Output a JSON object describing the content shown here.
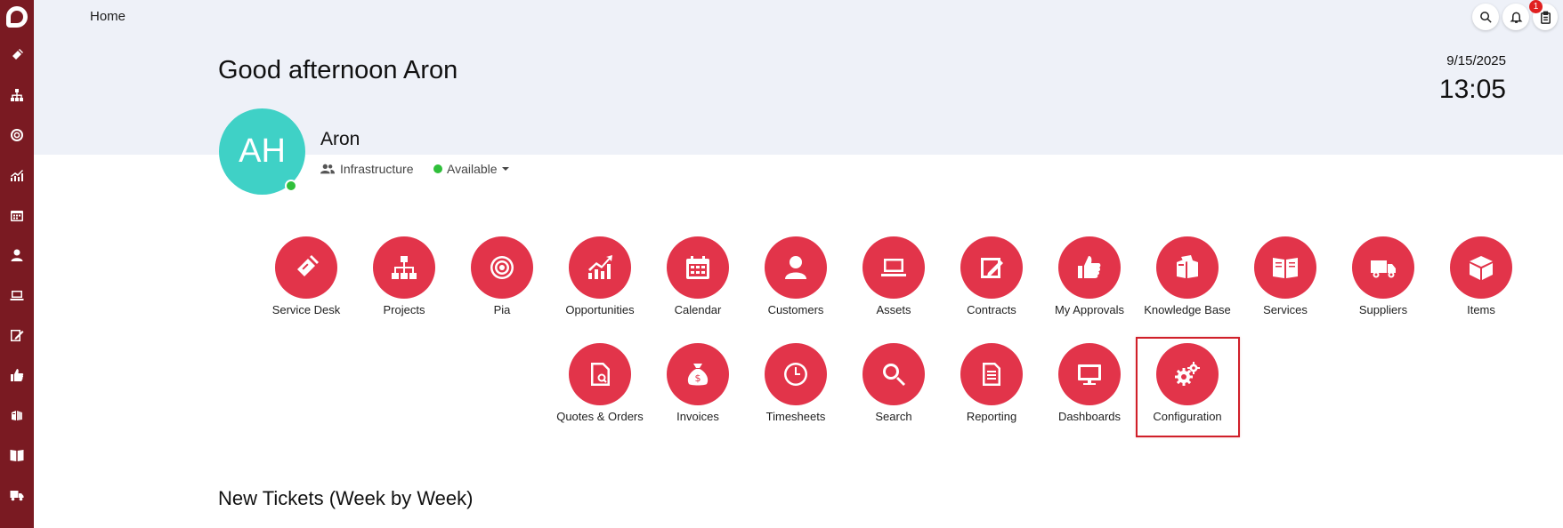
{
  "rail": {
    "icons": [
      "app-logo",
      "ticket-icon",
      "org-chart-icon",
      "target-icon",
      "chart-icon",
      "calendar-icon",
      "user-icon",
      "laptop-icon",
      "edit-icon",
      "thumbs-up-icon",
      "boxes-icon",
      "book-icon",
      "truck-icon"
    ]
  },
  "header": {
    "breadcrumb": "Home",
    "notification_count": "1"
  },
  "greeting": "Good afternoon Aron",
  "date": "9/15/2025",
  "time": "13:05",
  "profile": {
    "initials": "AH",
    "name": "Aron",
    "team": "Infrastructure",
    "status": "Available"
  },
  "tiles": {
    "row1": [
      {
        "label": "Service Desk",
        "icon": "ticket-icon"
      },
      {
        "label": "Projects",
        "icon": "org-chart-icon"
      },
      {
        "label": "Pia",
        "icon": "target-icon"
      },
      {
        "label": "Opportunities",
        "icon": "chart-icon"
      },
      {
        "label": "Calendar",
        "icon": "calendar-icon"
      },
      {
        "label": "Customers",
        "icon": "user-icon"
      },
      {
        "label": "Assets",
        "icon": "laptop-icon"
      },
      {
        "label": "Contracts",
        "icon": "edit-icon"
      },
      {
        "label": "My Approvals",
        "icon": "thumbs-up-icon"
      },
      {
        "label": "Knowledge Base",
        "icon": "boxes-icon"
      },
      {
        "label": "Services",
        "icon": "book-icon"
      },
      {
        "label": "Suppliers",
        "icon": "truck-icon"
      },
      {
        "label": "Items",
        "icon": "box-icon"
      }
    ],
    "row2": [
      {
        "label": "Quotes & Orders",
        "icon": "quote-doc-icon"
      },
      {
        "label": "Invoices",
        "icon": "money-bag-icon"
      },
      {
        "label": "Timesheets",
        "icon": "clock-icon"
      },
      {
        "label": "Search",
        "icon": "search-icon"
      },
      {
        "label": "Reporting",
        "icon": "report-icon"
      },
      {
        "label": "Dashboards",
        "icon": "monitor-icon"
      },
      {
        "label": "Configuration",
        "icon": "gears-icon"
      }
    ]
  },
  "selected_tile": "Configuration",
  "section_title": "New Tickets (Week by Week)",
  "colors": {
    "rail": "#7a1a22",
    "banner": "#eef1f8",
    "tile": "#e2344a",
    "avatar": "#3fd1c6",
    "presence": "#2fbf3a",
    "highlight": "#d0202a"
  }
}
